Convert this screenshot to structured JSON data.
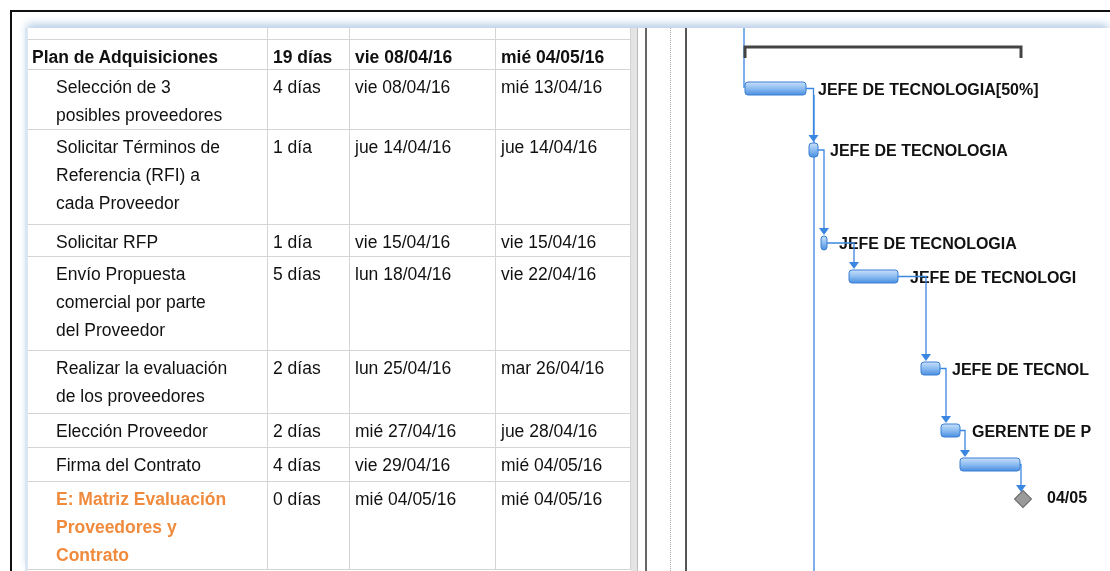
{
  "tasks": [
    {
      "kind": "summary",
      "name": "Plan de Adquisiciones",
      "duration": "19 días",
      "start": "vie 08/04/16",
      "finish": "mié 04/05/16"
    },
    {
      "kind": "task",
      "name": "Selección de 3\nposibles proveedores",
      "duration": "4 días",
      "start": "vie 08/04/16",
      "finish": "mié 13/04/16",
      "bar_label": "JEFE DE TECNOLOGIA[50%]"
    },
    {
      "kind": "task",
      "name": "Solicitar Términos de\nReferencia (RFI) a\ncada Proveedor",
      "duration": "1 día",
      "start": "jue 14/04/16",
      "finish": "jue 14/04/16",
      "bar_label": "JEFE DE TECNOLOGIA"
    },
    {
      "kind": "task",
      "name": "Solicitar RFP",
      "duration": "1 día",
      "start": "vie 15/04/16",
      "finish": "vie 15/04/16",
      "bar_label": "JEFE DE TECNOLOGIA"
    },
    {
      "kind": "task",
      "name": "Envío Propuesta\ncomercial por parte\ndel Proveedor",
      "duration": "5 días",
      "start": "lun 18/04/16",
      "finish": "vie 22/04/16",
      "bar_label": "JEFE DE TECNOLOGI"
    },
    {
      "kind": "task",
      "name": "Realizar la evaluación\nde los proveedores",
      "duration": "2 días",
      "start": "lun 25/04/16",
      "finish": "mar 26/04/16",
      "bar_label": "JEFE DE TECNOL"
    },
    {
      "kind": "task",
      "name": "Elección Proveedor",
      "duration": "2 días",
      "start": "mié 27/04/16",
      "finish": "jue 28/04/16",
      "bar_label": "GERENTE DE P"
    },
    {
      "kind": "task",
      "name": "Firma del Contrato",
      "duration": "4 días",
      "start": "vie 29/04/16",
      "finish": "mié 04/05/16"
    },
    {
      "kind": "milestone",
      "name": "E: Matriz Evaluación\nProveedores y\nContrato",
      "duration": "0 días",
      "start": "mié 04/05/16",
      "finish": "mié 04/05/16",
      "bar_label": "04/05"
    }
  ]
}
